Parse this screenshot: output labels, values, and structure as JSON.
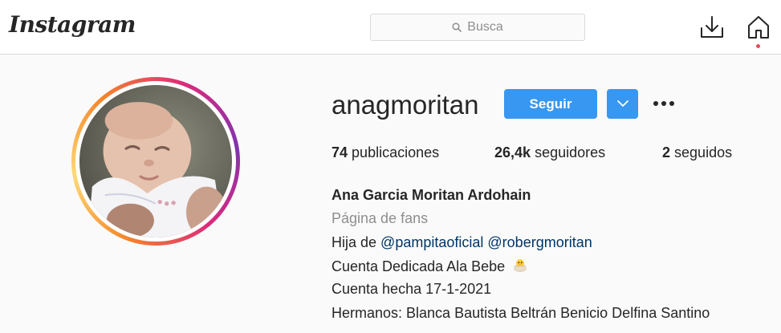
{
  "header": {
    "logo": "Instagram",
    "search_placeholder": "Busca"
  },
  "profile": {
    "username": "anagmoritan",
    "follow_label": "Seguir",
    "stats": {
      "posts_count": "74",
      "posts_label": "publicaciones",
      "followers_count": "26,4k",
      "followers_label": "seguidores",
      "following_count": "2",
      "following_label": "seguidos"
    },
    "bio": {
      "full_name": "Ana Garcia Moritan Ardohain",
      "category": "Página de fans",
      "line1_prefix": "Hija de",
      "mention1": "@pampitaoficial",
      "mention2": "@robergmoritan",
      "line2": "Cuenta Dedicada Ala Bebe",
      "line2_emoji": "hatching-chick-icon",
      "line3": "Cuenta hecha 17-1-2021",
      "line4": "Hermanos: Blanca Bautista Beltrán Benicio Delfina Santino"
    }
  },
  "colors": {
    "accent": "#3897f0",
    "mention": "#003569",
    "muted": "#8e8e8e",
    "notification": "#ed4956"
  }
}
